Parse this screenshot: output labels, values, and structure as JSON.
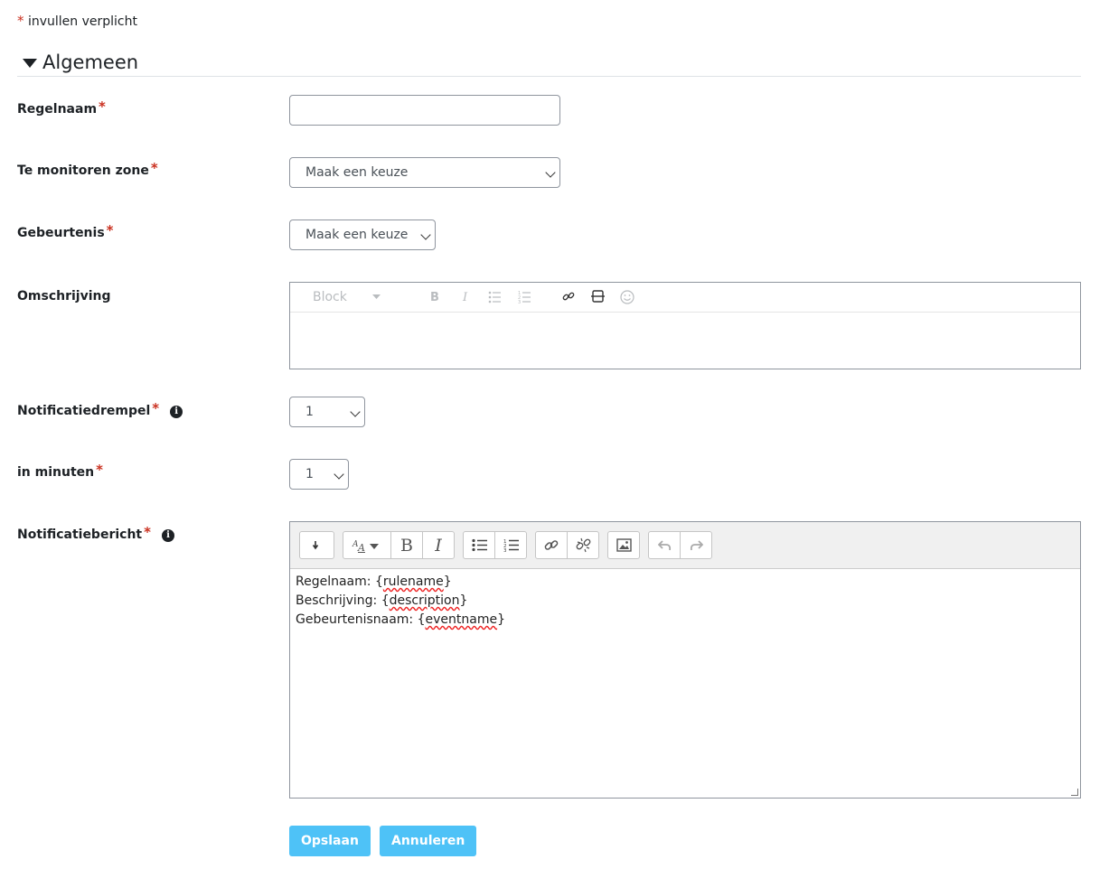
{
  "required_note": "invullen verplicht",
  "required_star": "*",
  "section": {
    "title": "Algemeen"
  },
  "fields": {
    "regelnaam": {
      "label": "Regelnaam",
      "value": ""
    },
    "zone": {
      "label": "Te monitoren zone",
      "value": "Maak een keuze"
    },
    "gebeurtenis": {
      "label": "Gebeurtenis",
      "value": "Maak een keuze"
    },
    "omschrijving": {
      "label": "Omschrijving",
      "block_label": "Block"
    },
    "drempel": {
      "label": "Notificatiedrempel",
      "value": "1"
    },
    "minuten": {
      "label": "in minuten",
      "value": "1"
    },
    "bericht": {
      "label": "Notificatiebericht",
      "line1_prefix": "Regelnaam: {",
      "line1_ph": "rulename",
      "line2_prefix": "Beschrijving: {",
      "line2_ph": "description",
      "line3_prefix": "Gebeurtenisnaam: {",
      "line3_ph": "eventname",
      "close_brace": "}"
    }
  },
  "buttons": {
    "save": "Opslaan",
    "cancel": "Annuleren"
  },
  "colors": {
    "required": "#ca3120",
    "primary_button": "#4ec2f7"
  }
}
